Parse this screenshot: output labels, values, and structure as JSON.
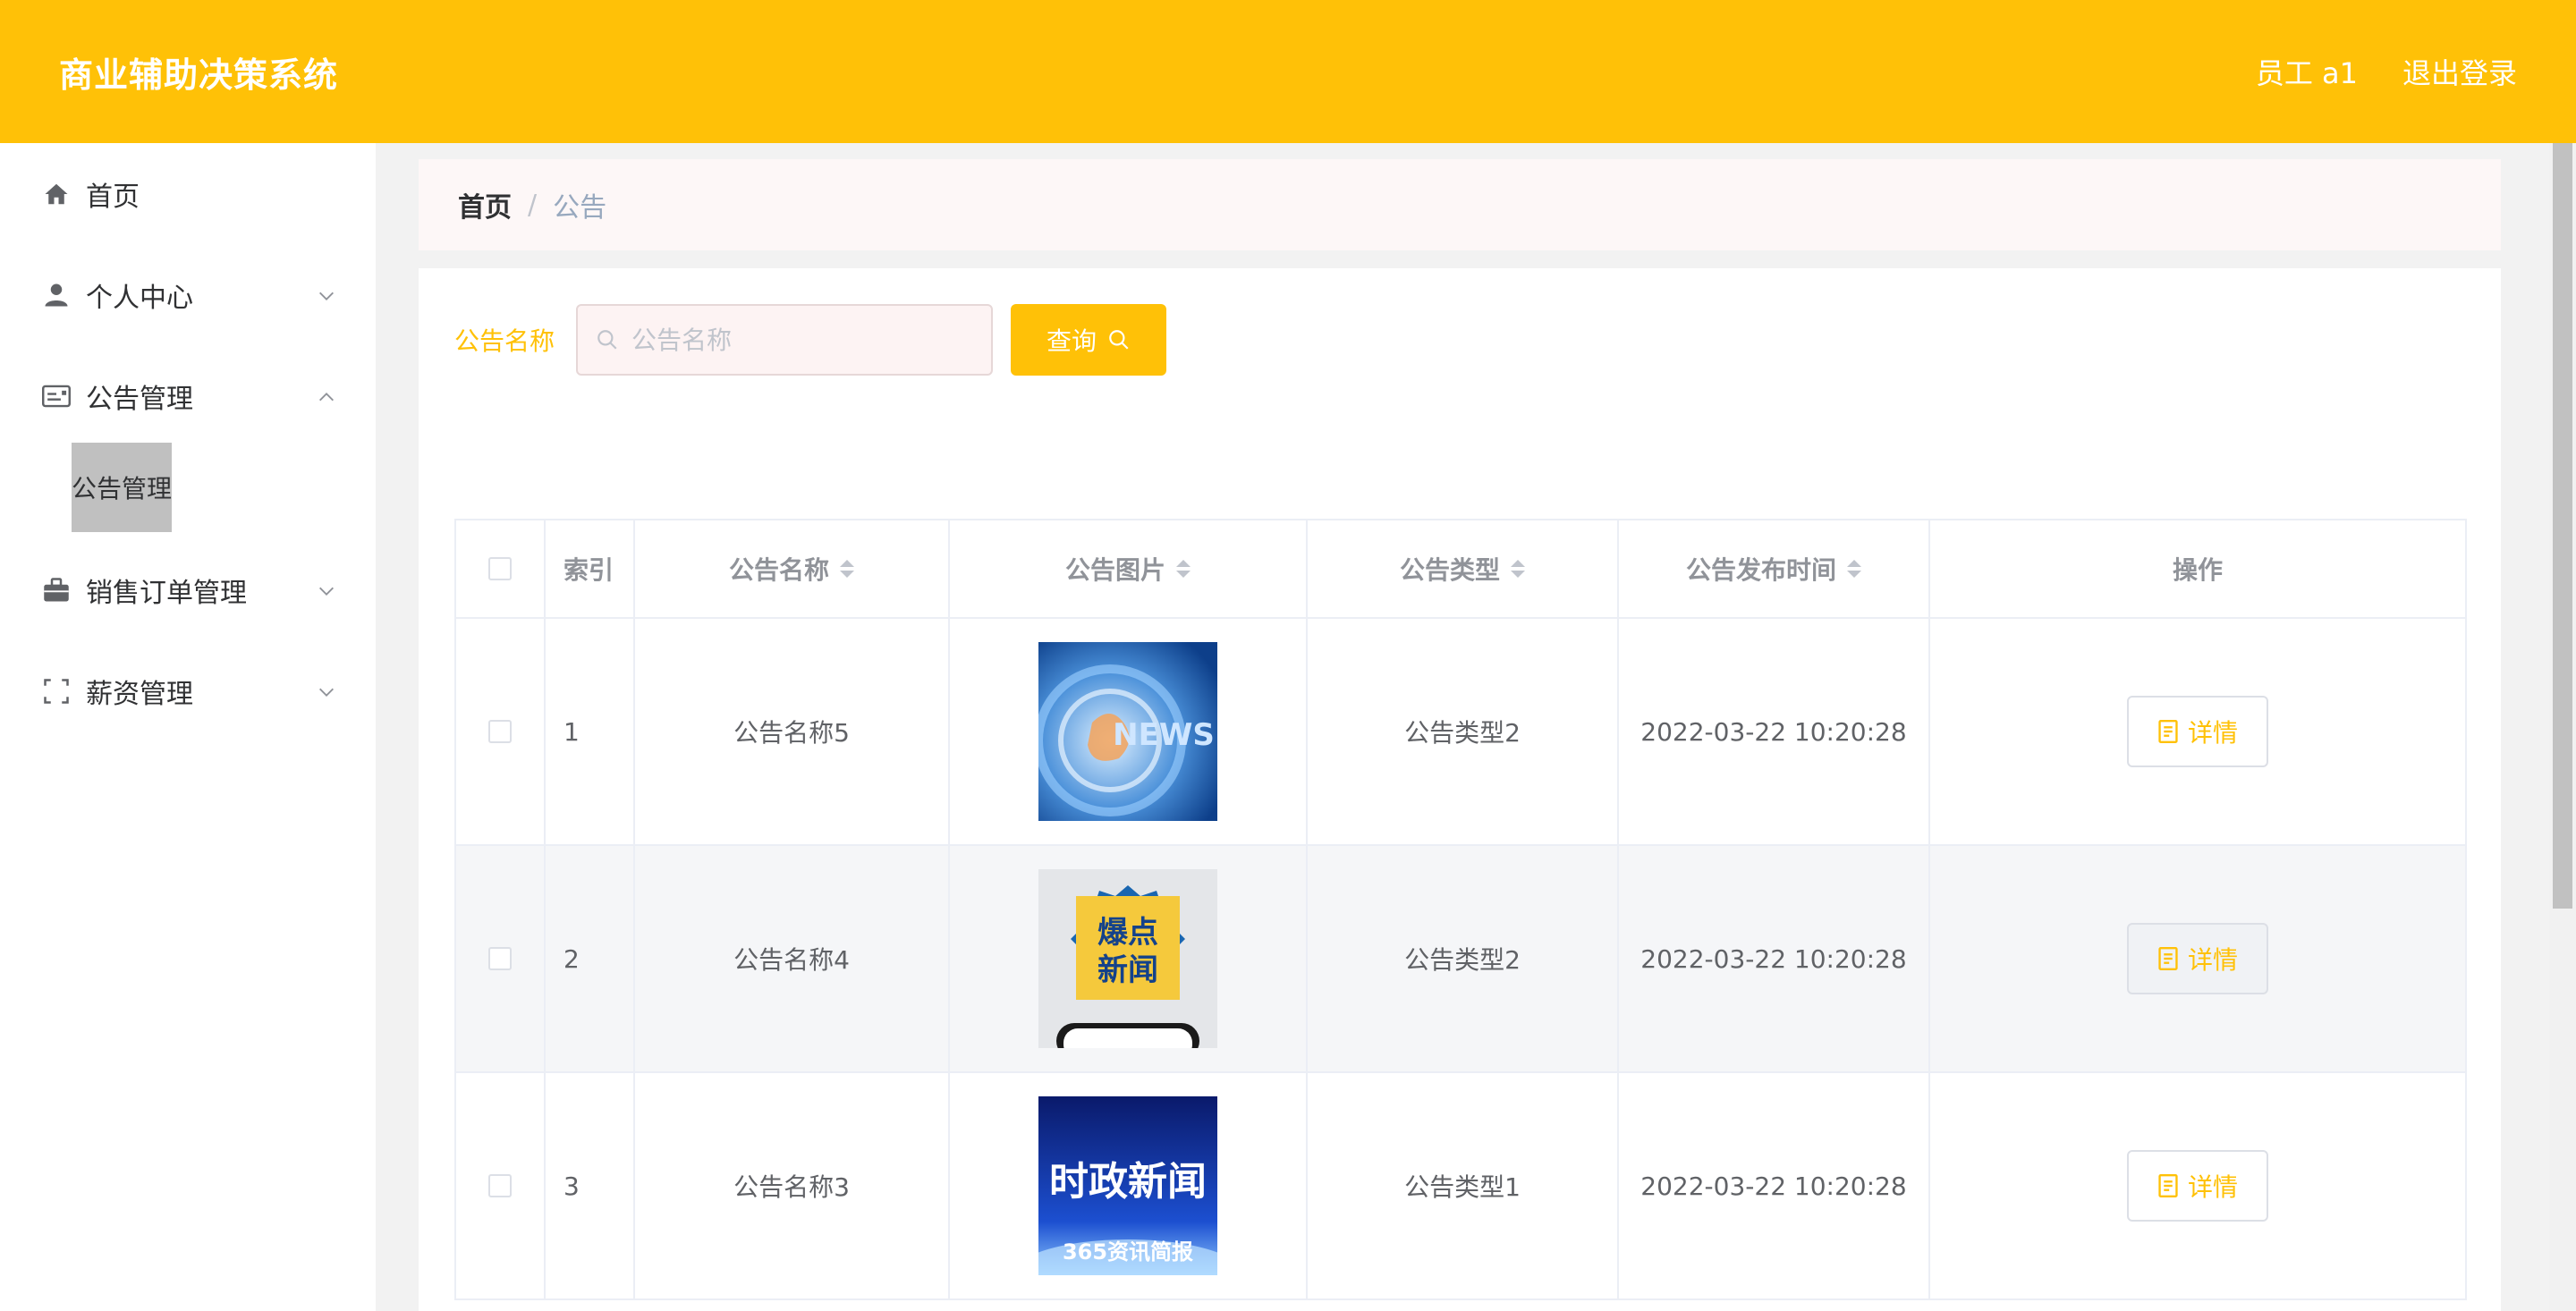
{
  "header": {
    "title": "商业辅助决策系统",
    "user_label": "员工 a1",
    "logout_label": "退出登录",
    "accent_color": "#ffc107"
  },
  "sidebar": {
    "items": [
      {
        "label": "首页",
        "icon": "home-icon"
      },
      {
        "label": "个人中心",
        "icon": "user-icon",
        "expandable": true
      },
      {
        "label": "公告管理",
        "icon": "notice-icon",
        "expanded": true,
        "children": [
          {
            "label": "公告管理"
          }
        ]
      },
      {
        "label": "销售订单管理",
        "icon": "briefcase-icon",
        "expandable": true
      },
      {
        "label": "薪资管理",
        "icon": "frame-icon",
        "expandable": true
      }
    ]
  },
  "breadcrumb": {
    "home": "首页",
    "separator": "/",
    "current": "公告"
  },
  "search": {
    "label": "公告名称",
    "placeholder": "公告名称",
    "value": "",
    "button_label": "查询"
  },
  "table": {
    "columns": [
      "索引",
      "公告名称",
      "公告图片",
      "公告类型",
      "公告发布时间",
      "操作"
    ],
    "rows": [
      {
        "index": "1",
        "name": "公告名称5",
        "image": "NEWS",
        "type": "公告类型2",
        "time": "2022-03-22 10:20:28",
        "action": "详情"
      },
      {
        "index": "2",
        "name": "公告名称4",
        "image": "爆点新闻",
        "type": "公告类型2",
        "time": "2022-03-22 10:20:28",
        "action": "详情"
      },
      {
        "index": "3",
        "name": "公告名称3",
        "image_title": "时政新闻",
        "image_subtitle": "365资讯简报",
        "type": "公告类型1",
        "time": "2022-03-22 10:20:28",
        "action": "详情"
      }
    ]
  }
}
